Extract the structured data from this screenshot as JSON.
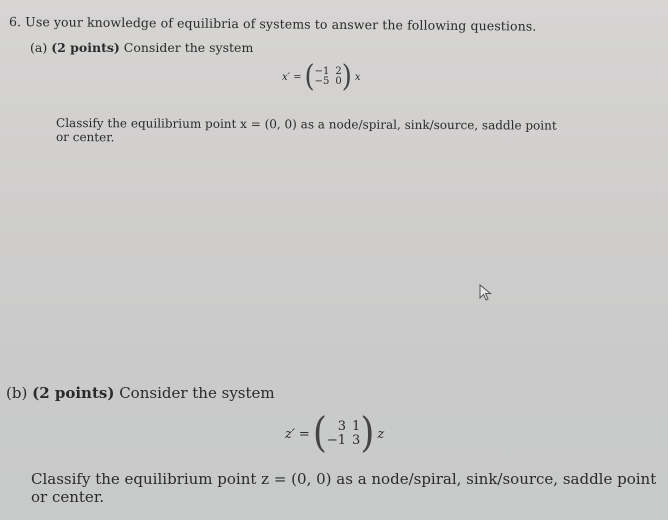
{
  "question": {
    "number": "6.",
    "prompt": "Use your knowledge of equilibria of systems to answer the following questions."
  },
  "part_a": {
    "label": "(a)",
    "points": "(2 points)",
    "intro": "Consider the system",
    "equation": {
      "lhs": "x′ =",
      "matrix": [
        [
          "−1",
          "2"
        ],
        [
          "−5",
          "0"
        ]
      ],
      "rhs": "x"
    },
    "classify_text": "Classify the equilibrium point x = (0, 0) as a node/spiral, sink/source, saddle point",
    "classify_text_cont": "or center."
  },
  "part_b": {
    "label": "(b)",
    "points": "(2 points)",
    "intro": "Consider the system",
    "equation": {
      "lhs": "z′ =",
      "matrix": [
        [
          "3",
          "1"
        ],
        [
          "−1",
          "3"
        ]
      ],
      "rhs": "z"
    },
    "classify_text": "Classify the equilibrium point z = (0, 0) as a node/spiral, sink/source, saddle point",
    "classify_text_cont": "or center."
  },
  "cursor": {
    "icon": "mouse-pointer-icon"
  }
}
